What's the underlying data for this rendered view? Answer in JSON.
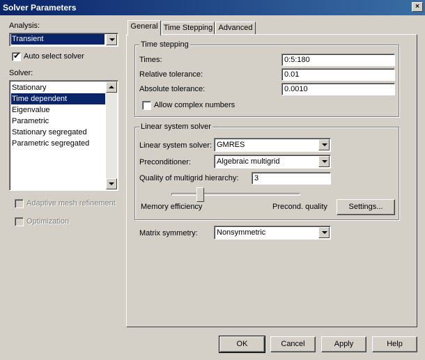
{
  "window": {
    "title": "Solver Parameters",
    "close_glyph": "×"
  },
  "left": {
    "analysis_label": "Analysis:",
    "analysis_value": "Transient",
    "auto_select_label": "Auto select solver",
    "auto_select_checked": true,
    "solver_label": "Solver:",
    "solvers": [
      "Stationary",
      "Time dependent",
      "Eigenvalue",
      "Parametric",
      "Stationary segregated",
      "Parametric segregated"
    ],
    "selected_solver": "Time dependent",
    "adaptive_label": "Adaptive mesh refinement",
    "optimization_label": "Optimization"
  },
  "tabs": [
    "General",
    "Time Stepping",
    "Advanced"
  ],
  "active_tab": "General",
  "time_stepping": {
    "title": "Time stepping",
    "times_label": "Times:",
    "times_value": "0:5:180",
    "rel_tol_label": "Relative tolerance:",
    "rel_tol_value": "0.01",
    "abs_tol_label": "Absolute tolerance:",
    "abs_tol_value": "0.0010",
    "complex_label": "Allow complex numbers",
    "complex_checked": false
  },
  "linear": {
    "title": "Linear system solver",
    "solver_label": "Linear system solver:",
    "solver_value": "GMRES",
    "precond_label": "Preconditioner:",
    "precond_value": "Algebraic multigrid",
    "quality_label": "Quality of multigrid hierarchy:",
    "quality_value": "3",
    "slider_min_label": "Memory efficiency",
    "slider_max_label": "Precond. quality",
    "settings_button": "Settings..."
  },
  "matrix": {
    "label": "Matrix symmetry:",
    "value": "Nonsymmetric"
  },
  "buttons": {
    "ok": "OK",
    "cancel": "Cancel",
    "apply": "Apply",
    "help": "Help"
  },
  "icons": {
    "checked": "✓",
    "check-glyph": "✔"
  },
  "colors": {
    "title_start": "#0a246a",
    "title_end": "#3a6ea5",
    "selection": "#0a246a",
    "face": "#d4d0c8"
  }
}
